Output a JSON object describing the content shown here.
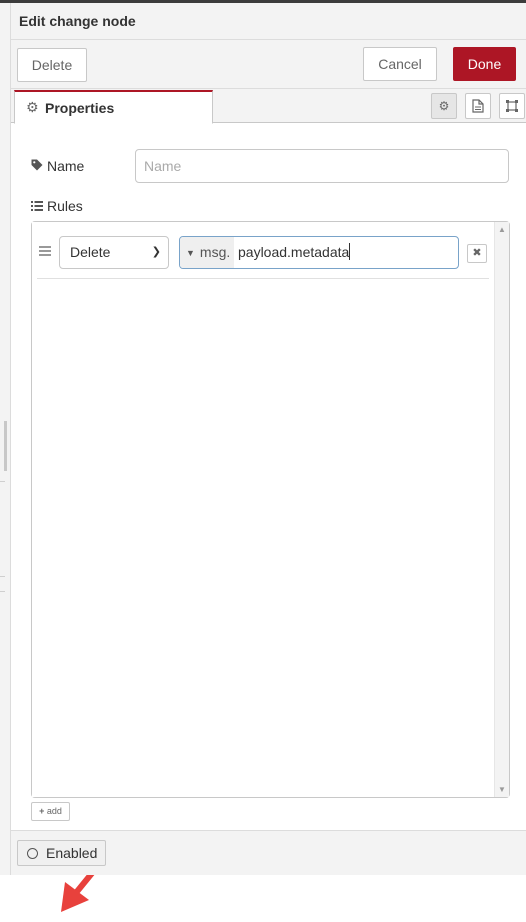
{
  "tray": {
    "title": "Edit change node",
    "toolbar": {
      "delete_label": "Delete",
      "cancel_label": "Cancel",
      "done_label": "Done"
    },
    "tabs": [
      {
        "label": "Properties",
        "icon": "gear-icon"
      }
    ],
    "tab_icons": [
      "gear-icon",
      "document-icon",
      "frame-icon"
    ]
  },
  "form": {
    "name": {
      "label": "Name",
      "value": "",
      "placeholder": "Name",
      "icon": "tag-icon"
    },
    "rules": {
      "label": "Rules",
      "icon": "list-icon",
      "items": [
        {
          "action": "Delete",
          "type": "msg.",
          "value": "payload.metadata"
        }
      ],
      "add_label": "add"
    }
  },
  "footer": {
    "enabled_label": "Enabled"
  },
  "colors": {
    "accent": "#ad1625",
    "annotation_arrow": "#e8413c",
    "focus_border": "#79a3c9"
  }
}
